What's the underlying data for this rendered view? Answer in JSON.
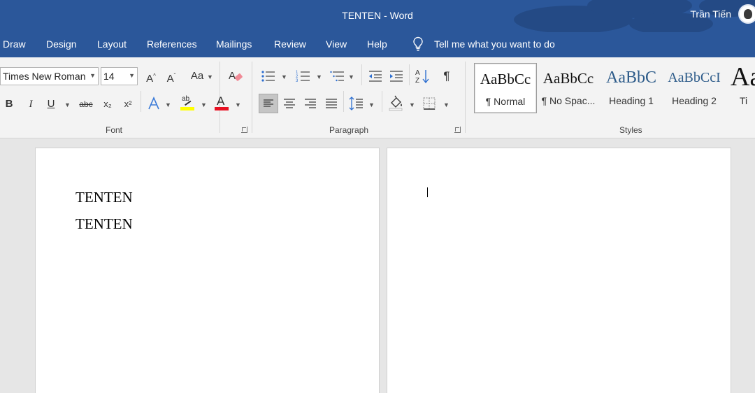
{
  "window": {
    "title": "TENTEN  -  Word",
    "user": "Trần Tiến"
  },
  "menu": {
    "tabs": [
      "Draw",
      "Design",
      "Layout",
      "References",
      "Mailings",
      "Review",
      "View",
      "Help"
    ],
    "tell_me": "Tell me what you want to do"
  },
  "ribbon": {
    "font": {
      "group_label": "Font",
      "font_name": "Times New Roman",
      "font_size": "14",
      "change_case_label": "Aa",
      "bold_label": "B",
      "italic_label": "I",
      "underline_label": "U",
      "strike_label": "abc",
      "subscript_label": "x₂",
      "superscript_label": "x²",
      "highlight_label": "ab",
      "font_color_label": "A",
      "highlight_color": "#ffff00",
      "font_color": "#e81123"
    },
    "paragraph": {
      "group_label": "Paragraph",
      "show_marks_label": "¶",
      "sort_label": "A Z"
    },
    "styles": {
      "group_label": "Styles",
      "items": [
        {
          "sample": "AaBbCc",
          "name": "¶ Normal"
        },
        {
          "sample": "AaBbCc",
          "name": "¶ No Spac..."
        },
        {
          "sample": "AaBbC",
          "name": "Heading 1"
        },
        {
          "sample": "AaBbCcI",
          "name": "Heading 2"
        },
        {
          "sample": "Aa",
          "name": "Ti"
        }
      ]
    }
  },
  "document": {
    "page1_lines": [
      "TENTEN",
      "TENTEN"
    ]
  },
  "colors": {
    "accent": "#2b579a",
    "heading_style": "#2e5c8a"
  }
}
